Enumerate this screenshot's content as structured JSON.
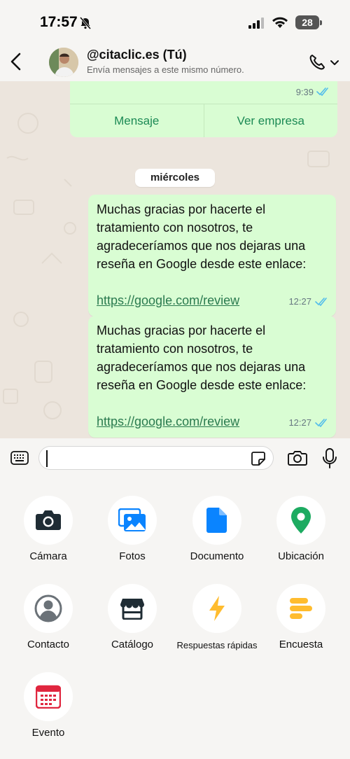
{
  "status_bar": {
    "time": "17:57",
    "battery": "28"
  },
  "header": {
    "contact_name": "@citaclic.es (Tú)",
    "contact_subtitle": "Envía mensajes a este mismo número."
  },
  "business_card": {
    "time": "9:39",
    "buttons": [
      "Mensaje",
      "Ver empresa"
    ]
  },
  "date_chip": "miércoles",
  "messages": [
    {
      "text": "Muchas gracias por hacerte el tratamiento con nosotros, te agradeceríamos que nos dejaras una reseña en Google desde este enlace:",
      "link": "https://google.com/review",
      "time": "12:27"
    },
    {
      "text": "Muchas gracias por hacerte el tratamiento con nosotros, te agradeceríamos que nos dejaras una reseña en Google desde este enlace:",
      "link": "https://google.com/review",
      "time": "12:27"
    }
  ],
  "composer": {
    "placeholder": ""
  },
  "attach_menu": [
    {
      "label": "Cámara",
      "icon": "camera-icon",
      "color": "#1f2c34"
    },
    {
      "label": "Fotos",
      "icon": "photos-icon",
      "color": "#0a84ff"
    },
    {
      "label": "Documento",
      "icon": "document-icon",
      "color": "#0a84ff"
    },
    {
      "label": "Ubicación",
      "icon": "location-pin-icon",
      "color": "#1dab61"
    },
    {
      "label": "Contacto",
      "icon": "contact-icon",
      "color": "#6b7278"
    },
    {
      "label": "Catálogo",
      "icon": "storefront-icon",
      "color": "#1f2c34"
    },
    {
      "label": "Respuestas rápidas",
      "icon": "lightning-icon",
      "color": "#ffbc2e"
    },
    {
      "label": "Encuesta",
      "icon": "poll-icon",
      "color": "#ffbc2e"
    },
    {
      "label": "Evento",
      "icon": "calendar-icon",
      "color": "#e0263f"
    }
  ],
  "colors": {
    "bubble_green": "#d9fdd3",
    "accent_green": "#1c8a55",
    "read_ticks": "#53bdeb",
    "background": "#f6f5f3"
  }
}
